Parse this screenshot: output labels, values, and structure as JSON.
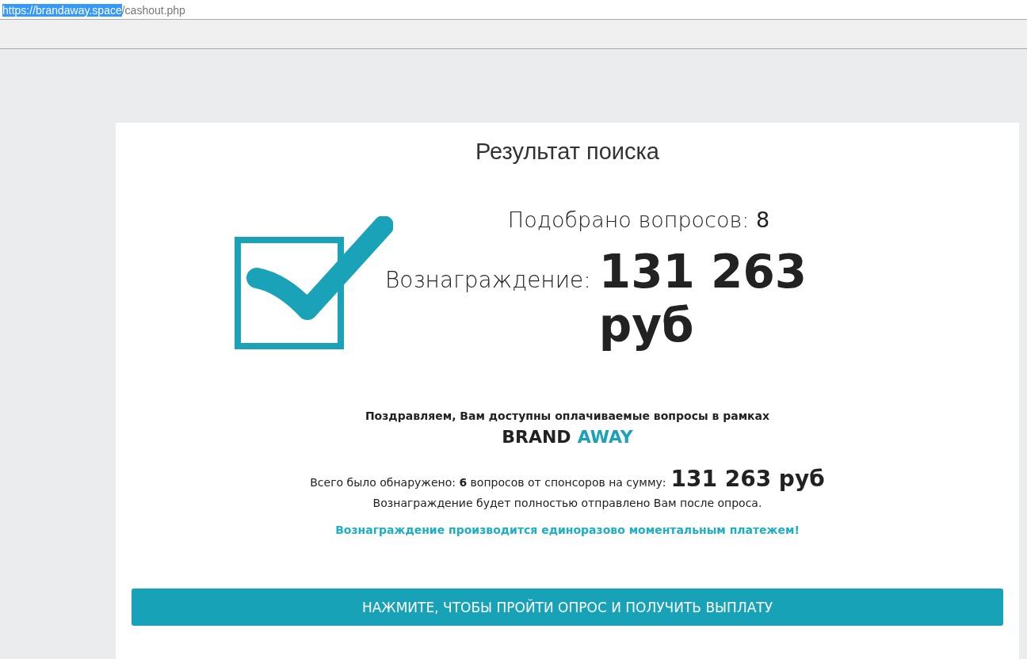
{
  "address_bar": {
    "host": "https://brandaway.space",
    "path": "/cashout.php",
    "host_selected": true
  },
  "card": {
    "title": "Результат поиска",
    "questions_line": "Подобрано вопросов: **8**",
    "reward_label": "Вознаграждение:",
    "reward_amount": "131 263 руб",
    "congrats": "Поздравляем, Вам доступны оплачиваемые вопросы в рамках",
    "brand": [
      {
        "text": "BRAND",
        "accent": false
      },
      {
        "text": "AWAY",
        "accent": true
      }
    ],
    "found_line": "Всего было обнаружено: **6** вопросов от спонсоров на сумму:",
    "found_amount": "131 263 руб",
    "sent_line": "Вознаграждение будет полностью отправлено Вам после опроса.",
    "payment_note": "Вознаграждение производится единоразово моментальным платежем!",
    "button": "НАЖМИТЕ, ЧТОБЫ ПРОЙТИ ОПРОС И ПОЛУЧИТЬ ВЫПЛАТУ"
  }
}
